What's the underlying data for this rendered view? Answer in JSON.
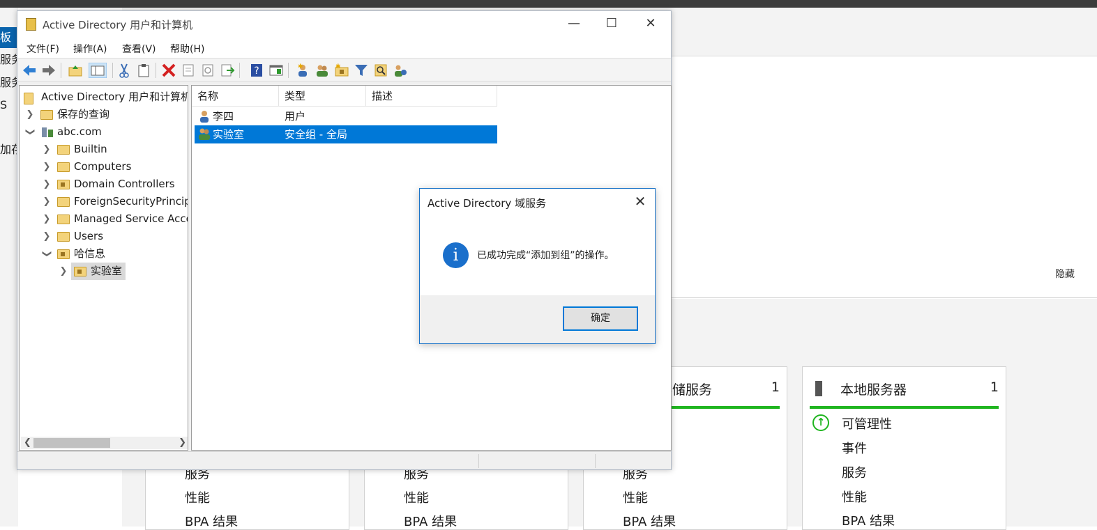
{
  "server_manager": {
    "left_nav": [
      "板",
      "服务",
      "服务",
      "S",
      "加存"
    ],
    "hide_label": "隐藏",
    "tiles": [
      {
        "title": "",
        "count": "",
        "rows": [
          "服务",
          "性能",
          "BPA 结果"
        ]
      },
      {
        "title": "",
        "count": "",
        "rows": [
          "服务",
          "性能",
          "BPA 结果"
        ]
      },
      {
        "title": "存储服务",
        "count": "1",
        "rows": [
          "服务",
          "性能",
          "BPA 结果"
        ]
      },
      {
        "title": "本地服务器",
        "count": "1",
        "rows": [
          "可管理性",
          "事件",
          "服务",
          "性能",
          "BPA 结果"
        ]
      }
    ]
  },
  "window": {
    "title": "Active Directory 用户和计算机",
    "controls": {
      "minimize": "—",
      "maximize": "☐",
      "close": "✕"
    },
    "menu": [
      "文件(F)",
      "操作(A)",
      "查看(V)",
      "帮助(H)"
    ]
  },
  "tree": {
    "root": "Active Directory 用户和计算机",
    "saved_queries": "保存的查询",
    "domain": "abc.com",
    "children": [
      "Builtin",
      "Computers",
      "Domain Controllers",
      "ForeignSecurityPrincipals",
      "Managed Service Accounts",
      "Users",
      "哈信息"
    ],
    "sub_child": "实验室"
  },
  "list": {
    "columns": [
      "名称",
      "类型",
      "描述"
    ],
    "rows": [
      {
        "name": "李四",
        "type": "用户",
        "desc": ""
      },
      {
        "name": "实验室",
        "type": "安全组 - 全局",
        "desc": ""
      }
    ]
  },
  "dialog": {
    "title": "Active Directory 域服务",
    "message": "已成功完成“添加到组”的操作。",
    "ok_label": "确定",
    "close_glyph": "✕",
    "info_glyph": "i"
  },
  "icons": {
    "accent": "#0078d7",
    "status_green": "#1fb51f"
  }
}
